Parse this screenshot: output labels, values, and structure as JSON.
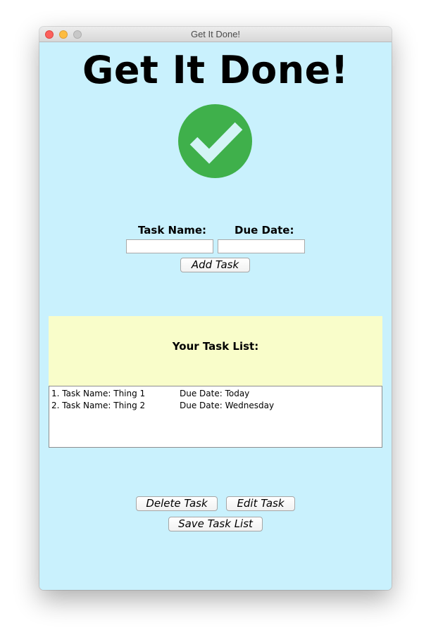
{
  "window": {
    "title": "Get It Done!"
  },
  "header": {
    "app_title": "Get It Done!",
    "logo_icon": "checkmark-circle-icon",
    "logo_color": "#3fb04b"
  },
  "form": {
    "task_name_label": "Task Name:",
    "due_date_label": "Due Date:",
    "task_name_value": "",
    "due_date_value": "",
    "add_button_label": "Add Task"
  },
  "task_list": {
    "heading": "Your Task List:",
    "items": [
      {
        "name": "1. Task Name: Thing 1",
        "due": "Due Date: Today"
      },
      {
        "name": "2. Task Name: Thing 2",
        "due": "Due Date: Wednesday"
      }
    ]
  },
  "actions": {
    "delete_label": "Delete Task",
    "edit_label": "Edit Task",
    "save_label": "Save Task List"
  },
  "colors": {
    "background": "#c9f1fd",
    "list_header_bg": "#f9fdca"
  }
}
